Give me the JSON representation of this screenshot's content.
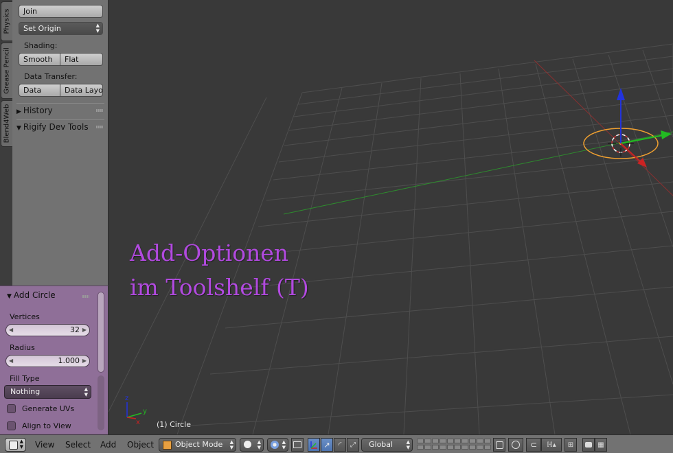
{
  "vertical_tabs": [
    "Physics",
    "Grease Pencil",
    "Blend4Web"
  ],
  "toolshelf": {
    "join_label": "Join",
    "set_origin_label": "Set Origin",
    "shading_label": "Shading:",
    "smooth_label": "Smooth",
    "flat_label": "Flat",
    "data_transfer_label": "Data Transfer:",
    "data_label": "Data",
    "data_layout_label": "Data Layo",
    "history_label": "History",
    "rigify_label": "Rigify Dev Tools"
  },
  "operator_panel": {
    "title": "Add Circle",
    "vertices_label": "Vertices",
    "vertices_value": "32",
    "radius_label": "Radius",
    "radius_value": "1.000",
    "fill_type_label": "Fill Type",
    "fill_type_value": "Nothing",
    "generate_uvs_label": "Generate UVs",
    "align_to_view_label": "Align to View"
  },
  "viewport": {
    "overlay_line1": "Add-Optionen",
    "overlay_line2": "im Toolshelf (T)",
    "object_label": "(1) Circle",
    "axis_x": "x",
    "axis_y": "y",
    "axis_z": "z"
  },
  "header": {
    "menus": [
      "View",
      "Select",
      "Add",
      "Object"
    ],
    "mode_label": "Object Mode",
    "orientation_label": "Global"
  },
  "colors": {
    "overlay_text": "#b24ae0",
    "operator_panel_bg": "#8f6f98",
    "viewport_bg": "#393939",
    "x_axis": "#cc2222",
    "y_axis": "#22aa22",
    "z_axis": "#2233dd",
    "selection": "#f0a030"
  }
}
